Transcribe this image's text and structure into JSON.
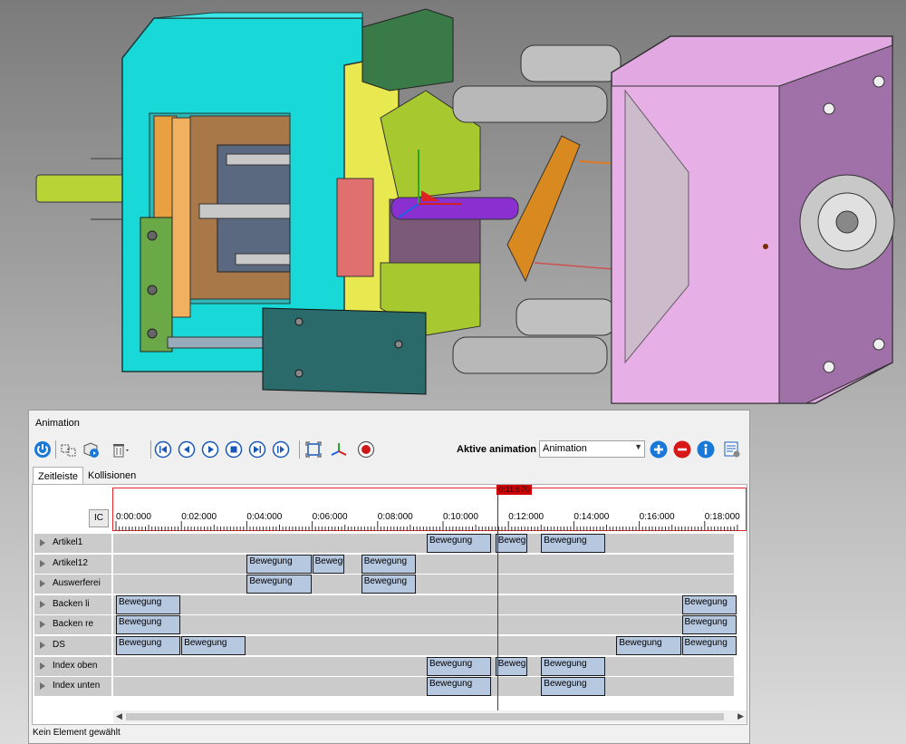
{
  "panel": {
    "title": "Animation"
  },
  "toolbar": {
    "icons": [
      "power-icon",
      "group-cubes-icon",
      "cube-play-icon",
      "trash-dropdown-icon",
      "skip-to-start-icon",
      "step-back-icon",
      "play-icon",
      "stop-icon",
      "skip-to-end-icon",
      "step-forward-icon",
      "fit-frame-icon",
      "coordinate-axes-icon",
      "record-icon",
      "add-icon",
      "remove-icon",
      "info-icon",
      "settings-list-icon"
    ],
    "active_animation_label": "Aktive animation",
    "active_animation_value": "Animation"
  },
  "tabs": [
    {
      "label": "Zeitleiste",
      "active": true
    },
    {
      "label": "Kollisionen",
      "active": false
    }
  ],
  "timeline": {
    "ic_label": "IC",
    "ticks": [
      "0:00:000",
      "0:02:000",
      "0:04:000",
      "0:06:000",
      "0:08:000",
      "0:10:000",
      "0:12:000",
      "0:14:000",
      "0:16:000",
      "0:18:000"
    ],
    "current_time": "0:11:670",
    "current_time_seconds": 11.67,
    "rows": [
      {
        "name": "Artikel1",
        "segments": [
          {
            "label": "Bewegung",
            "start": 9.5,
            "end": 11.5
          },
          {
            "label": "Bewegu",
            "start": 11.6,
            "end": 12.6
          },
          {
            "label": "Bewegung",
            "start": 13.0,
            "end": 15.0
          }
        ]
      },
      {
        "name": "Artikel12",
        "segments": [
          {
            "label": "Bewegung",
            "start": 4.0,
            "end": 6.0
          },
          {
            "label": "Bewegu",
            "start": 6.0,
            "end": 7.0
          },
          {
            "label": "Bewegung",
            "start": 7.5,
            "end": 9.2
          }
        ]
      },
      {
        "name": "Auswerferei",
        "segments": [
          {
            "label": "Bewegung",
            "start": 4.0,
            "end": 6.0
          },
          {
            "label": "Bewegung",
            "start": 7.5,
            "end": 9.2
          }
        ]
      },
      {
        "name": "Backen li",
        "segments": [
          {
            "label": "Bewegung",
            "start": 0.0,
            "end": 2.0
          },
          {
            "label": "Bewegung",
            "start": 17.3,
            "end": 19.0
          }
        ]
      },
      {
        "name": "Backen re",
        "segments": [
          {
            "label": "Bewegung",
            "start": 0.0,
            "end": 2.0
          },
          {
            "label": "Bewegung",
            "start": 17.3,
            "end": 19.0
          }
        ]
      },
      {
        "name": "DS",
        "segments": [
          {
            "label": "Bewegung",
            "start": 0.0,
            "end": 2.0
          },
          {
            "label": "Bewegung",
            "start": 2.0,
            "end": 4.0
          },
          {
            "label": "Bewegung",
            "start": 15.3,
            "end": 17.3
          },
          {
            "label": "Bewegung",
            "start": 17.3,
            "end": 19.0
          }
        ]
      },
      {
        "name": "Index oben",
        "segments": [
          {
            "label": "Bewegung",
            "start": 9.5,
            "end": 11.5
          },
          {
            "label": "Bewegu",
            "start": 11.6,
            "end": 12.6
          },
          {
            "label": "Bewegung",
            "start": 13.0,
            "end": 15.0
          }
        ]
      },
      {
        "name": "Index unten",
        "segments": [
          {
            "label": "Bewegung",
            "start": 9.5,
            "end": 11.5
          },
          {
            "label": "Bewegung",
            "start": 13.0,
            "end": 15.0
          }
        ]
      }
    ]
  },
  "status": "Kein Element gewählt"
}
